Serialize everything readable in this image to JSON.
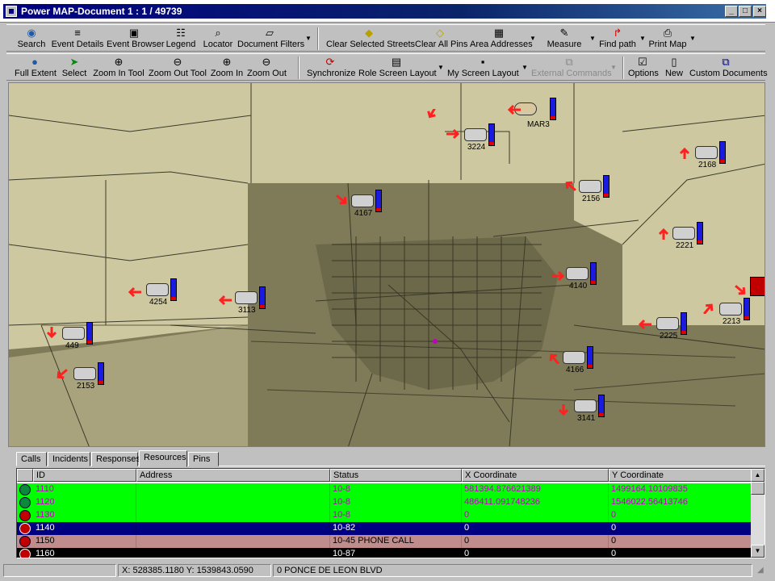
{
  "window": {
    "title": "Power MAP-Document 1 : 1 / 49739"
  },
  "toolbar1": [
    {
      "label": "Search",
      "icon": "search-icon"
    },
    {
      "label": "Event Details",
      "icon": "list-icon"
    },
    {
      "label": "Event Browser",
      "icon": "browser-icon"
    },
    {
      "label": "Legend",
      "icon": "legend-icon"
    },
    {
      "label": "Locator",
      "icon": "locator-icon"
    },
    {
      "label": "Document Filters",
      "icon": "filter-icon"
    },
    {
      "label": "Clear Selected Streets",
      "icon": "eraser-icon"
    },
    {
      "label": "Clear All Pins",
      "icon": "eraser-icon"
    },
    {
      "label": "Area Addresses",
      "icon": "area-icon"
    },
    {
      "label": "Measure",
      "icon": "ruler-icon"
    },
    {
      "label": "Find path",
      "icon": "path-icon"
    },
    {
      "label": "Print Map",
      "icon": "printer-icon"
    }
  ],
  "toolbar2": [
    {
      "label": "Full Extent",
      "icon": "globe-icon"
    },
    {
      "label": "Select",
      "icon": "cursor-icon"
    },
    {
      "label": "Zoom In Tool",
      "icon": "zoom-in-icon"
    },
    {
      "label": "Zoom Out Tool",
      "icon": "zoom-out-icon"
    },
    {
      "label": "Zoom In",
      "icon": "zoom-in-icon"
    },
    {
      "label": "Zoom Out",
      "icon": "zoom-out-icon"
    },
    {
      "label": "Synchronize",
      "icon": "sync-icon"
    },
    {
      "label": "Role Screen Layout",
      "icon": "layout-icon"
    },
    {
      "label": "My Screen Layout",
      "icon": "save-icon"
    },
    {
      "label": "External Commands",
      "icon": "external-icon"
    },
    {
      "label": "Options",
      "icon": "options-icon"
    },
    {
      "label": "New",
      "icon": "new-doc-icon"
    },
    {
      "label": "Custom Documents",
      "icon": "documents-icon"
    }
  ],
  "map": {
    "units": [
      "MAR3",
      "3224",
      "2168",
      "2156",
      "4167",
      "2221",
      "4140",
      "4254",
      "3113",
      "2213",
      "449",
      "2225",
      "2153",
      "4166",
      "3141"
    ]
  },
  "tabs": [
    "Calls",
    "Incidents",
    "Responses",
    "Resources",
    "Pins"
  ],
  "active_tab": "Resources",
  "grid": {
    "columns": [
      "ID",
      "Address",
      "Status",
      "X Coordinate",
      "Y Coordinate"
    ],
    "rows": [
      {
        "id": "1110",
        "address": "",
        "status": "10-8",
        "x": "581394.876621389",
        "y": "1499164.10109835"
      },
      {
        "id": "1120",
        "address": "",
        "status": "10-8",
        "x": "486411.091748236",
        "y": "1546022.56413746"
      },
      {
        "id": "1130",
        "address": "",
        "status": "10-8",
        "x": "0",
        "y": "0"
      },
      {
        "id": "1140",
        "address": "",
        "status": "10-82",
        "x": "0",
        "y": "0"
      },
      {
        "id": "1150",
        "address": "",
        "status": "10-45 PHONE CALL",
        "x": "0",
        "y": "0"
      },
      {
        "id": "1160",
        "address": "",
        "status": "10-87",
        "x": "0",
        "y": "0"
      }
    ]
  },
  "status": {
    "coords": "X: 528385.1180  Y: 1539843.0590",
    "address": "0 PONCE DE LEON BLVD"
  },
  "colors": {
    "title_bar": "#0a246a",
    "row_green": "#00ff00",
    "row_navy": "#000080",
    "row_pink": "#c08c8c",
    "row_black": "#000000",
    "unit_bar": "#1a1ae0",
    "arrow": "#ff2020"
  }
}
